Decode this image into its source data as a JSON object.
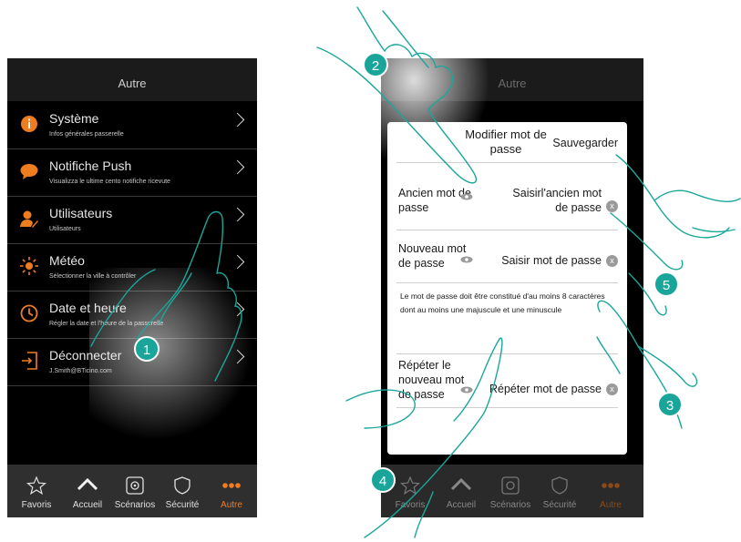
{
  "phone1": {
    "header_title": "Autre",
    "menu": [
      {
        "title": "Système",
        "subtitle": "Infos générales passerelle",
        "icon": "info-icon"
      },
      {
        "title": "Notifiche Push",
        "subtitle": "Visualizza le ultime cento notifiche ricevute",
        "icon": "chat-bubble-icon"
      },
      {
        "title": "Utilisateurs",
        "subtitle": "Utilisateurs",
        "icon": "user-edit-icon"
      },
      {
        "title": "Météo",
        "subtitle": "Sélectionner la ville à contrôler",
        "icon": "sun-icon"
      },
      {
        "title": "Date et heure",
        "subtitle": "Régler la date et l'heure de la passerelle",
        "icon": "clock-icon"
      },
      {
        "title": "Déconnecter",
        "subtitle": "J.Smith@BTicino.com",
        "icon": "logout-icon"
      }
    ]
  },
  "tabs": [
    {
      "label": "Favoris",
      "icon": "star-icon"
    },
    {
      "label": "Accueil",
      "icon": "home-icon"
    },
    {
      "label": "Scénarios",
      "icon": "scenario-icon"
    },
    {
      "label": "Sécurité",
      "icon": "shield-icon"
    },
    {
      "label": "Autre",
      "icon": "more-dots-icon"
    }
  ],
  "phone2": {
    "header_title": "Autre",
    "dialog": {
      "title": "Modifier mot de passe",
      "save_label": "Sauvegarder",
      "old_label": "Ancien mot de passe",
      "old_placeholder": "Saisirl'ancien mot de passe",
      "new_label": "Nouveau mot de passe",
      "new_placeholder": "Saisir mot de passe",
      "note": "Le mot de passe doit être constitué d'au moins 8 caractères dont au moins une majuscule et une minuscule",
      "repeat_label": "Répéter le nouveau mot de passe",
      "repeat_placeholder": "Répéter mot de passe",
      "clear_glyph": "x"
    }
  },
  "badges": [
    "1",
    "2",
    "3",
    "4",
    "5"
  ],
  "colors": {
    "accent": "#ef7d1f",
    "badge": "#1aa59a",
    "background": "#000000"
  }
}
